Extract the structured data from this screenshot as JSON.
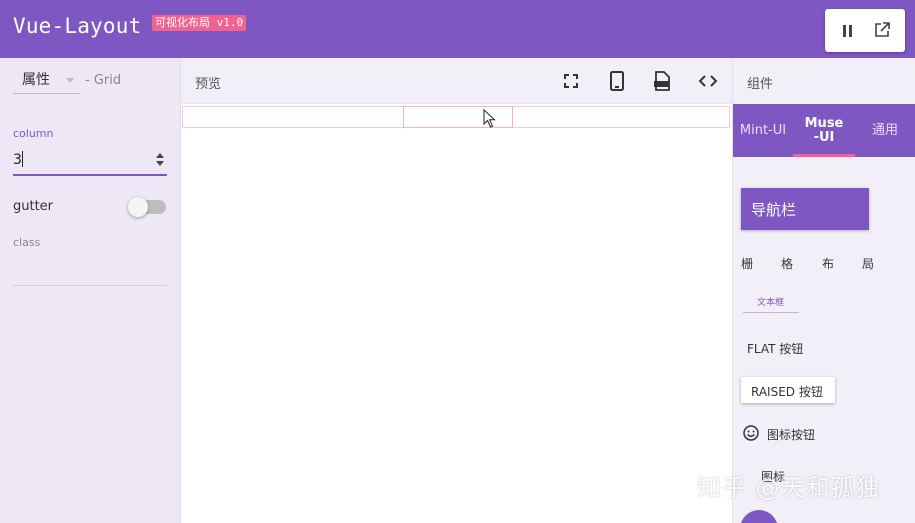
{
  "header": {
    "title": "Vue-Layout",
    "version": "可视化布局 v1.0",
    "actions": [
      "pause-icon",
      "external-link-icon"
    ]
  },
  "properties": {
    "select_label": "属性",
    "component_type": "- Grid",
    "column_label": "column",
    "column_value": "3",
    "gutter_label": "gutter",
    "gutter_enabled": false,
    "class_label": "class",
    "class_value": ""
  },
  "preview": {
    "title": "预览",
    "toolbar_icons": [
      "fullscreen-icon",
      "mobile-icon",
      "css-icon",
      "code-icon"
    ],
    "grid_columns": 3
  },
  "components": {
    "title": "组件",
    "tabs": [
      "Mint-UI",
      "Muse-UI",
      "通用"
    ],
    "active_tab": "Muse-UI",
    "items": {
      "navbar": "导航栏",
      "grid_words": [
        "栅",
        "格",
        "布",
        "局"
      ],
      "textfield": "文本框",
      "flat_button": "FLAT 按钮",
      "raised_button": "RAISED 按钮",
      "icon_button": "图标按钮",
      "icon": "图标"
    }
  },
  "watermark": "知乎 @天和孤独",
  "colors": {
    "primary": "#7e57c2",
    "accent": "#f06292",
    "panel": "#ede7f6"
  }
}
